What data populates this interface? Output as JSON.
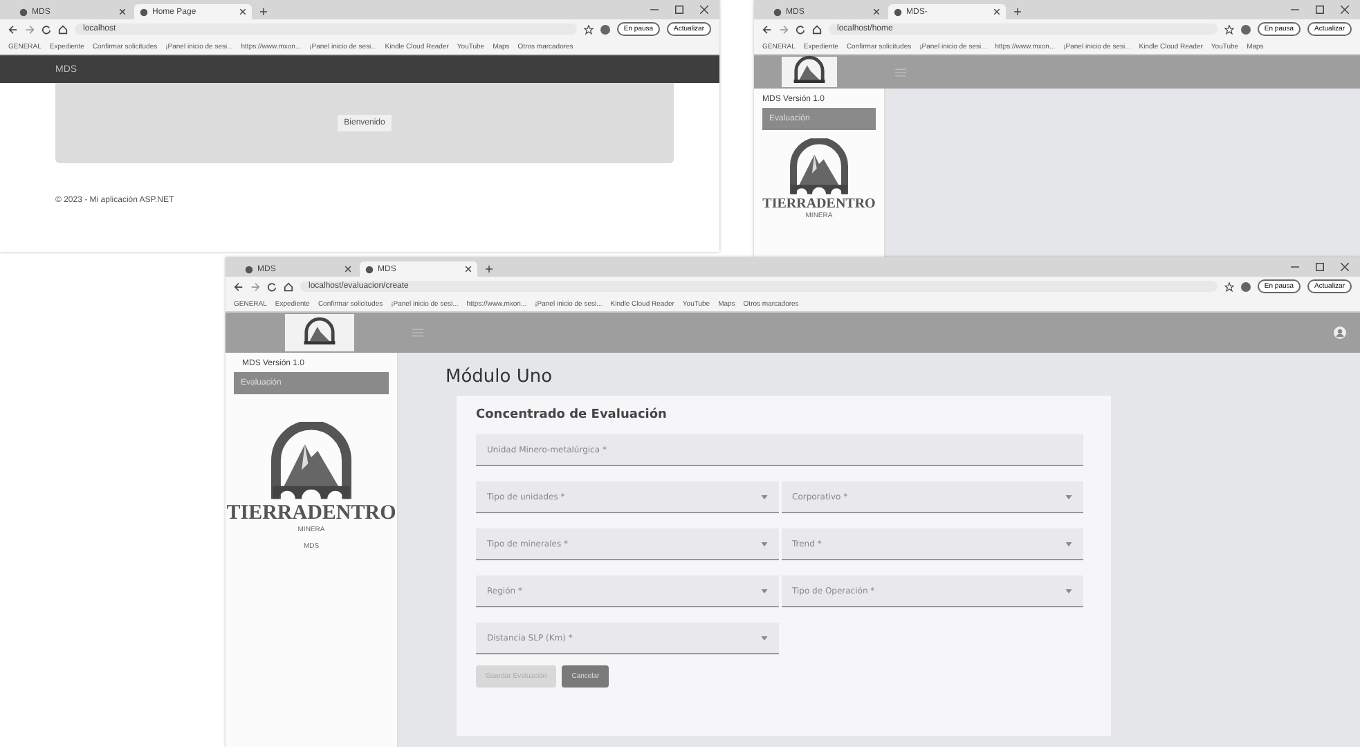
{
  "windows": [
    {
      "kind": "home",
      "tabs": [
        {
          "label": "MDS",
          "selected": false
        },
        {
          "label": "Home Page",
          "selected": true
        }
      ],
      "address": "localhost",
      "profile_buttons": [
        "En pausa",
        "Actualizar"
      ],
      "bookmarks": [
        "GENERAL",
        "Expediente",
        "Confirmar solicitudes",
        "¡Panel inicio de sesi...",
        "https://www.mxon...",
        "¡Panel inicio de sesi...",
        "Kindle Cloud Reader",
        "YouTube",
        "Maps",
        "Otros marcadores"
      ],
      "app": {
        "brand": "MDS",
        "welcome": "Bienvenido",
        "footer": "© 2023 - Mi aplicación ASP.NET"
      }
    },
    {
      "kind": "dashboard",
      "tabs": [
        {
          "label": "MDS",
          "selected": false
        },
        {
          "label": "MDS-",
          "selected": true
        }
      ],
      "address": "localhost/home",
      "profile_buttons": [
        "En pausa",
        "Actualizar"
      ],
      "bookmarks": [
        "GENERAL",
        "Expediente",
        "Confirmar solicitudes",
        "¡Panel inicio de sesi...",
        "https://www.mxon...",
        "¡Panel inicio de sesi...",
        "Kindle Cloud Reader",
        "YouTube",
        "Maps"
      ],
      "app": {
        "version": "MDS Versión 1.0",
        "menu": [
          {
            "label": "Evaluación",
            "selected": true
          }
        ],
        "logo_title": "TIERRADENTRO",
        "logo_subtitle": "MINERA"
      }
    },
    {
      "kind": "form",
      "tabs": [
        {
          "label": "MDS",
          "selected": false
        },
        {
          "label": "MDS",
          "selected": true
        }
      ],
      "address": "localhost/evaluacion/create",
      "profile_buttons": [
        "En pausa",
        "Actualizar"
      ],
      "bookmarks": [
        "GENERAL",
        "Expediente",
        "Confirmar solicitudes",
        "¡Panel inicio de sesi...",
        "https://www.mxon...",
        "¡Panel inicio de sesi...",
        "Kindle Cloud Reader",
        "YouTube",
        "Maps",
        "Otros marcadores"
      ],
      "app": {
        "version": "MDS Versión 1.0",
        "menu": [
          {
            "label": "Evaluación",
            "selected": true
          }
        ],
        "logo_title": "TIERRADENTRO",
        "logo_subtitle": "MINERA",
        "logo_caption": "MDS",
        "page_title": "Módulo Uno",
        "form": {
          "title": "Concentrado de Evaluación",
          "fields": [
            {
              "kind": "text",
              "placeholder": "Unidad Minero-metalúrgica *"
            },
            {
              "kind": "select",
              "placeholder": "Tipo de unidades *"
            },
            {
              "kind": "select",
              "placeholder": "Corporativo *"
            },
            {
              "kind": "select",
              "placeholder": "Tipo de minerales *"
            },
            {
              "kind": "select",
              "placeholder": "Trend *"
            },
            {
              "kind": "select",
              "placeholder": "Región *"
            },
            {
              "kind": "select",
              "placeholder": "Tipo de Operación *"
            },
            {
              "kind": "select",
              "placeholder": "Distancia SLP (Km) *"
            }
          ],
          "buttons": [
            {
              "label": "Guardar Evaluación",
              "disabled": true
            },
            {
              "label": "Cancelar",
              "disabled": false
            }
          ]
        }
      }
    }
  ]
}
